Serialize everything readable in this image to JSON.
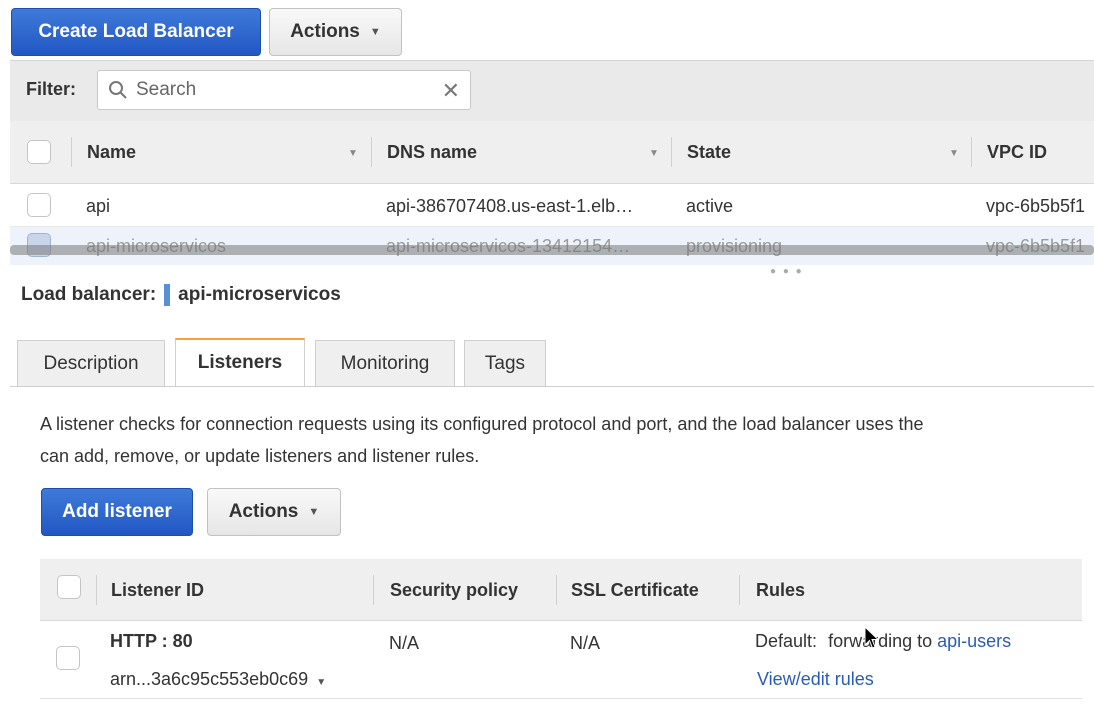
{
  "toolbar": {
    "create_label": "Create Load Balancer",
    "actions_label": "Actions"
  },
  "filter": {
    "label": "Filter:",
    "placeholder": "Search"
  },
  "lb_table": {
    "columns": [
      "Name",
      "DNS name",
      "State",
      "VPC ID"
    ],
    "rows": [
      {
        "name": "api",
        "dns": "api-386707408.us-east-1.elb…",
        "state": "active",
        "vpc": "vpc-6b5b5f1"
      },
      {
        "name": "api-microservicos",
        "dns": "api-microservicos-13412154…",
        "state": "provisioning",
        "vpc": "vpc-6b5b5f1"
      }
    ]
  },
  "detail": {
    "label": "Load balancer:",
    "name": "api-microservicos",
    "tabs": [
      "Description",
      "Listeners",
      "Monitoring",
      "Tags"
    ],
    "active_tab": "Listeners",
    "description_line1": "A listener checks for connection requests using its configured protocol and port, and the load balancer uses the",
    "description_line2": "can add, remove, or update listeners and listener rules."
  },
  "listeners": {
    "add_label": "Add listener",
    "actions_label": "Actions",
    "columns": [
      "Listener ID",
      "Security policy",
      "SSL Certificate",
      "Rules"
    ],
    "rows": [
      {
        "id": "HTTP : 80",
        "arn": "arn...3a6c95c553eb0c69",
        "security_policy": "N/A",
        "ssl_certificate": "N/A",
        "rules_default_label": "Default:",
        "rules_default_text": "forwarding to",
        "rules_target": "api-users",
        "view_edit_label": "View/edit rules"
      }
    ]
  },
  "colors": {
    "primary": "#2257c4",
    "tab_accent": "#f0a23c",
    "link": "#2b5bb8",
    "selection_bar": "#5b8fd6"
  }
}
